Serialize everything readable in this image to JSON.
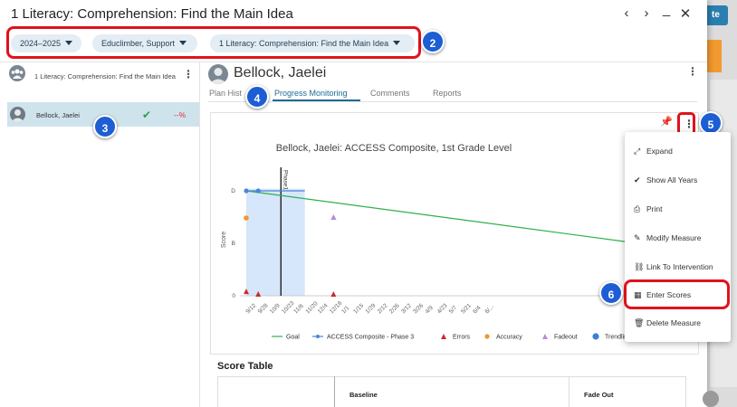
{
  "window": {
    "title": "1 Literacy: Comprehension: Find the Main Idea",
    "prev_icon": "‹",
    "next_icon": "›",
    "minimize_icon": "_",
    "close_icon": "✕"
  },
  "background_app": {
    "top_button_label": "te"
  },
  "filters": [
    {
      "label": "2024–2025"
    },
    {
      "label": "Educlimber, Support"
    },
    {
      "label": "1 Literacy: Comprehension: Find the Main Idea"
    }
  ],
  "badges": [
    "2",
    "3",
    "4",
    "5",
    "6"
  ],
  "sidebar": {
    "group_label": "1 Literacy: Comprehension: Find the Main Idea",
    "student": {
      "name": "Bellock, Jaelei",
      "check": "✔",
      "percent": "--%"
    }
  },
  "student_header": {
    "name": "Bellock, Jaelei"
  },
  "tabs": [
    {
      "label": "Plan Hist"
    },
    {
      "label": "Progress Monitoring"
    },
    {
      "label": "Comments"
    },
    {
      "label": "Reports"
    }
  ],
  "menu": {
    "items": [
      {
        "label": "Expand",
        "icon": "expand-icon"
      },
      {
        "label": "Show All Years",
        "icon": "double-check-icon"
      },
      {
        "label": "Print",
        "icon": "print-icon"
      },
      {
        "label": "Modify Measure",
        "icon": "edit-icon"
      },
      {
        "label": "Link To Intervention",
        "icon": "link-icon"
      },
      {
        "label": "Enter Scores",
        "icon": "table-icon"
      },
      {
        "label": "Delete Measure",
        "icon": "trash-icon"
      }
    ]
  },
  "chart_data": {
    "type": "line",
    "title": "Bellock, Jaelei: ACCESS Composite, 1st Grade Level",
    "ylabel": "Score",
    "y_ticks": [
      "0",
      "B",
      "D"
    ],
    "x_ticks": [
      "9/12",
      "9/28",
      "10/9",
      "10/23",
      "11/6",
      "11/20",
      "12/4",
      "12/18",
      "1/1",
      "1/15",
      "1/29",
      "2/12",
      "2/26",
      "3/12",
      "3/26",
      "4/9",
      "4/23",
      "5/7",
      "5/21",
      "6/4",
      "6/..."
    ],
    "phase_label": "Phase1",
    "series": [
      {
        "name": "Goal",
        "color": "#2eb04b",
        "points": [
          [
            0,
            2
          ],
          [
            19,
            1.5
          ]
        ]
      },
      {
        "name": "ACCESS Composite - Phase 3",
        "color": "#4a86d8",
        "points": [
          [
            0,
            2
          ],
          [
            1,
            2
          ],
          [
            4.9,
            2
          ]
        ]
      },
      {
        "name": "Errors",
        "color": "#cc2a2a",
        "points": [
          [
            0,
            0.05
          ],
          [
            1,
            0
          ],
          [
            7.3,
            0
          ]
        ]
      },
      {
        "name": "Accuracy",
        "color": "#f2952f",
        "points": [
          [
            0,
            1.5
          ]
        ]
      },
      {
        "name": "Fadeout",
        "color": "#b78bd8",
        "points": [
          [
            7.3,
            1.5
          ]
        ]
      },
      {
        "name": "Trendline",
        "color": "#3d7fd6",
        "points": []
      }
    ],
    "legend_position": "bottom",
    "baseline_shade": [
      0,
      4.9
    ]
  },
  "score_table": {
    "title": "Score Table",
    "headers": [
      "Baseline",
      "Fade Out"
    ]
  }
}
